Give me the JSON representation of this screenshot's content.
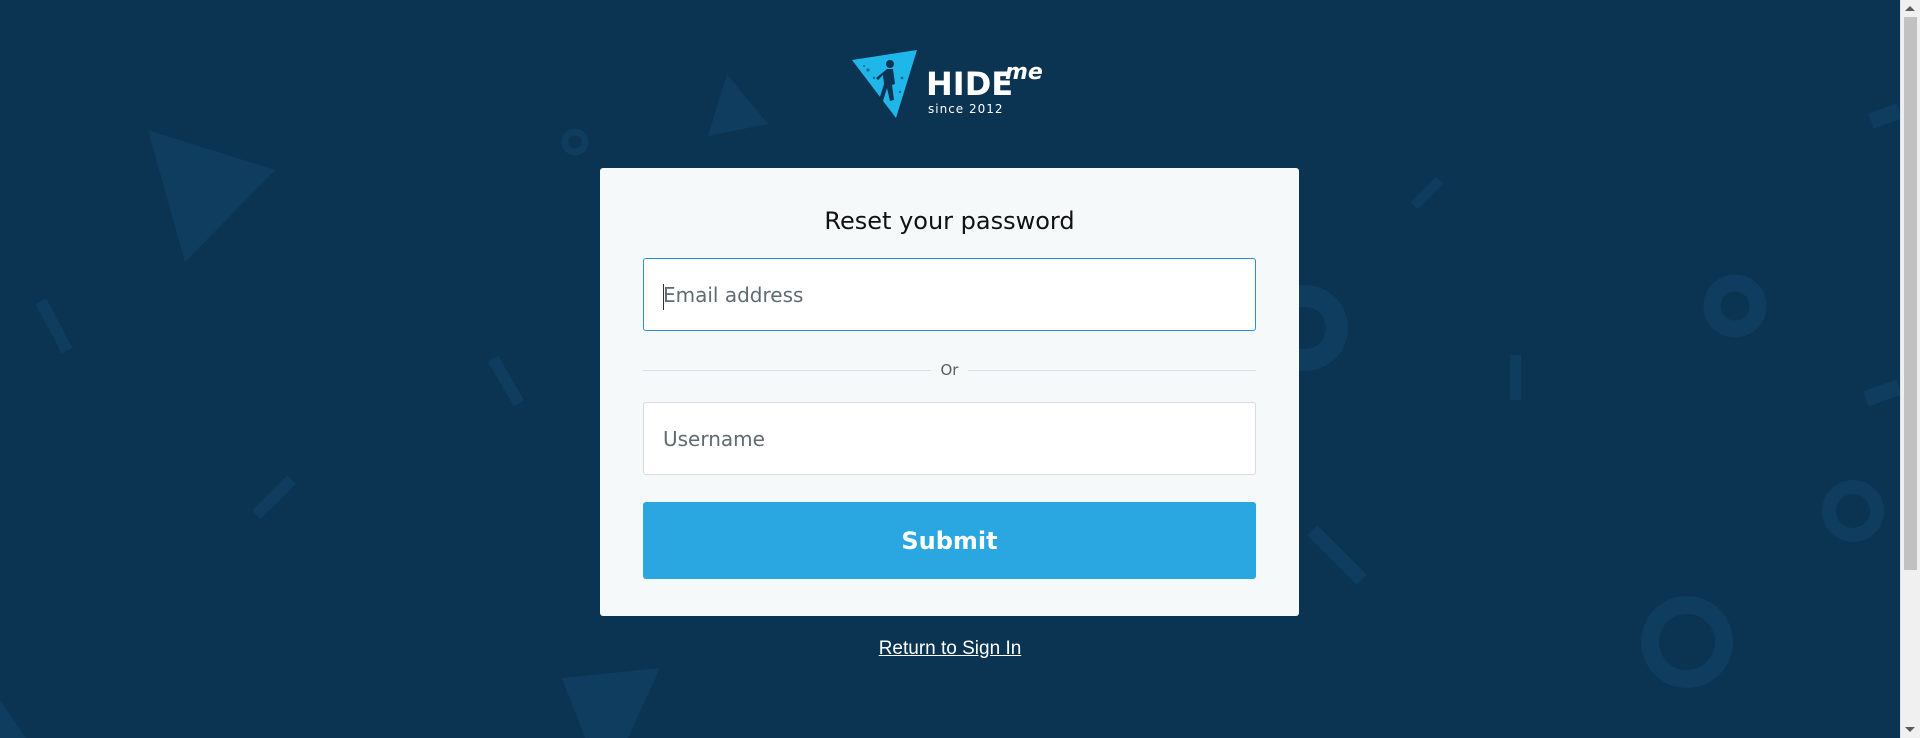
{
  "brand": {
    "name": "HIDE",
    "suffix": "me",
    "tagline": "since 2012",
    "logo_icon": "triangle-person-icon"
  },
  "form": {
    "title": "Reset your password",
    "email_placeholder": "Email address",
    "email_value": "",
    "divider_text": "Or",
    "username_placeholder": "Username",
    "username_value": "",
    "submit_label": "Submit"
  },
  "links": {
    "return_label": "Return to Sign In"
  },
  "colors": {
    "background": "#0b3352",
    "card": "#f5f9f9",
    "accent": "#2aa6e0",
    "focus_border": "#2a8fd0",
    "logo_blue": "#1fb6ea"
  }
}
